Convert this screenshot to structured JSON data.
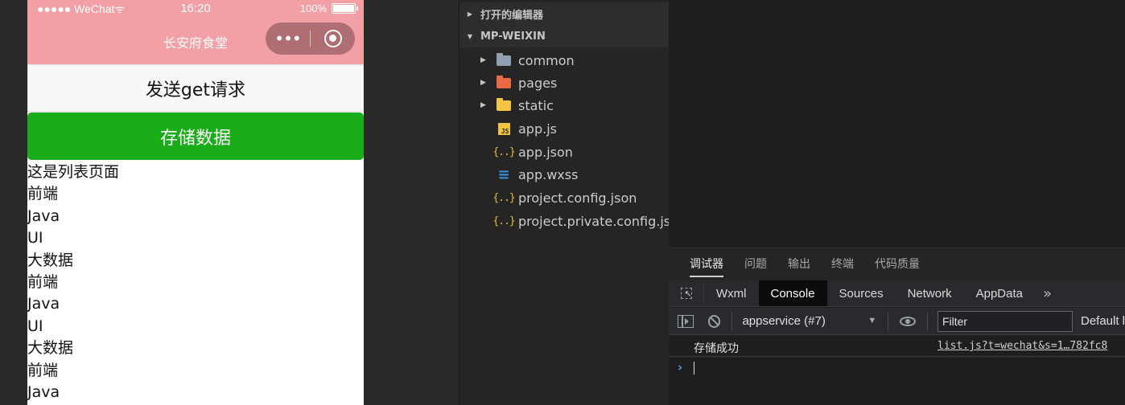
{
  "phone": {
    "status_bar": {
      "carrier": "●●●●● WeChat",
      "wifi": "ᯤ",
      "time": "16:20",
      "battery_pct": "100%"
    },
    "title": "长安府食堂",
    "capsule": {
      "more": "•••"
    },
    "buttons": {
      "get_request": "发送get请求",
      "store_data": "存储数据"
    },
    "list_title": "这是列表页面",
    "list_items": [
      "前端",
      "Java",
      "UI",
      "大数据",
      "前端",
      "Java",
      "UI",
      "大数据",
      "前端",
      "Java"
    ],
    "colors": {
      "header": "#f2a0a5",
      "primary_button": "#1aad19"
    }
  },
  "explorer": {
    "open_editors": "打开的编辑器",
    "project": "MP-WEIXIN",
    "tree": [
      {
        "label": "common",
        "kind": "folder",
        "icon": "folder-icon"
      },
      {
        "label": "pages",
        "kind": "folder",
        "icon": "folder-pages-icon"
      },
      {
        "label": "static",
        "kind": "folder",
        "icon": "folder-static-icon"
      },
      {
        "label": "app.js",
        "kind": "file",
        "icon": "js-file-icon"
      },
      {
        "label": "app.json",
        "kind": "file",
        "icon": "json-file-icon"
      },
      {
        "label": "app.wxss",
        "kind": "file",
        "icon": "css-file-icon"
      },
      {
        "label": "project.config.json",
        "kind": "file",
        "icon": "json-file-icon"
      },
      {
        "label": "project.private.config.js...",
        "kind": "file",
        "icon": "json-file-icon"
      }
    ],
    "icon_glyphs": {
      "js": "JS",
      "json": "{..}",
      "css": "≡"
    }
  },
  "devtools": {
    "top_tabs": [
      "调试器",
      "问题",
      "输出",
      "终端",
      "代码质量"
    ],
    "panel_tabs": [
      "Wxml",
      "Console",
      "Sources",
      "Network",
      "AppData"
    ],
    "more": "»",
    "context": "appservice (#7)",
    "filter_placeholder": "Filter",
    "levels": "Default l",
    "log": {
      "message": "存储成功",
      "source": "list.js?t=wechat&s=1…782fc8"
    },
    "prompt": "›"
  }
}
